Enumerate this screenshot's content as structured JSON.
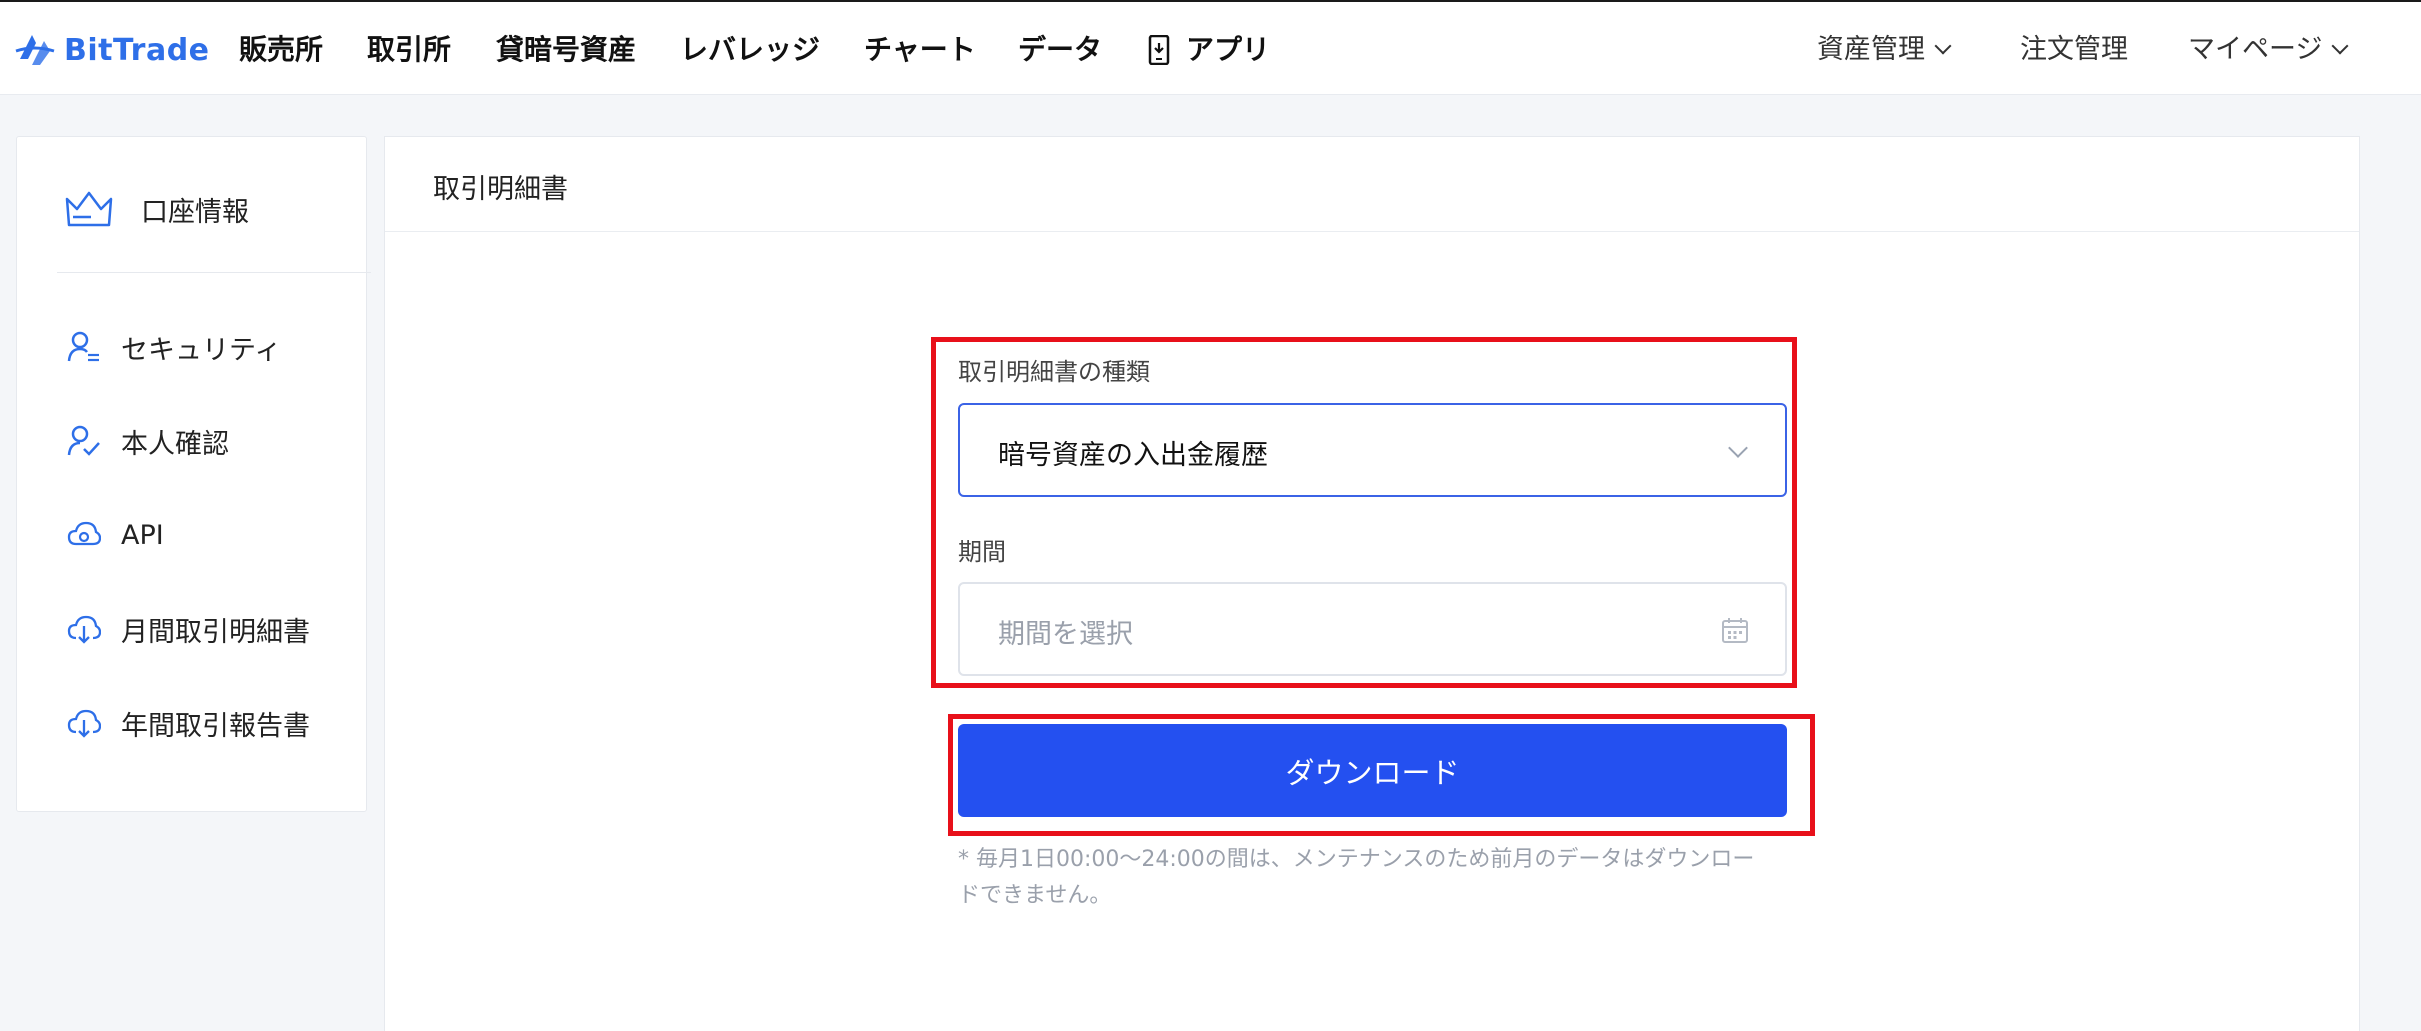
{
  "header": {
    "logo_text": "BitTrade",
    "nav": [
      {
        "label": "販売所"
      },
      {
        "label": "取引所"
      },
      {
        "label": "貸暗号資産"
      },
      {
        "label": "レバレッジ"
      },
      {
        "label": "チャート"
      },
      {
        "label": "データ"
      },
      {
        "label": "アプリ",
        "icon": "phone-icon"
      }
    ],
    "right": [
      {
        "label": "資産管理",
        "dropdown": true
      },
      {
        "label": "注文管理",
        "dropdown": false
      },
      {
        "label": "マイページ",
        "dropdown": true
      }
    ]
  },
  "sidebar": {
    "account": {
      "label": "口座情報",
      "icon": "crown-icon"
    },
    "items": [
      {
        "label": "セキュリティ",
        "icon": "user-list-icon"
      },
      {
        "label": "本人確認",
        "icon": "user-check-icon"
      },
      {
        "label": "API",
        "icon": "cloud-link-icon"
      },
      {
        "label": "月間取引明細書",
        "icon": "cloud-download-icon"
      },
      {
        "label": "年間取引報告書",
        "icon": "cloud-download-icon"
      }
    ]
  },
  "main": {
    "title": "取引明細書",
    "form": {
      "type_label": "取引明細書の種類",
      "type_value": "暗号資産の入出金履歴",
      "period_label": "期間",
      "period_placeholder": "期間を選択",
      "download_label": "ダウンロード",
      "note_line1": "* 毎月1日00:00～24:00の間は、メンテナンスのため前月のデータはダウンロー",
      "note_line2": "ドできません。"
    }
  },
  "colors": {
    "brand": "#2e6fe8",
    "button": "#2450f0",
    "highlight": "#e8101a"
  }
}
